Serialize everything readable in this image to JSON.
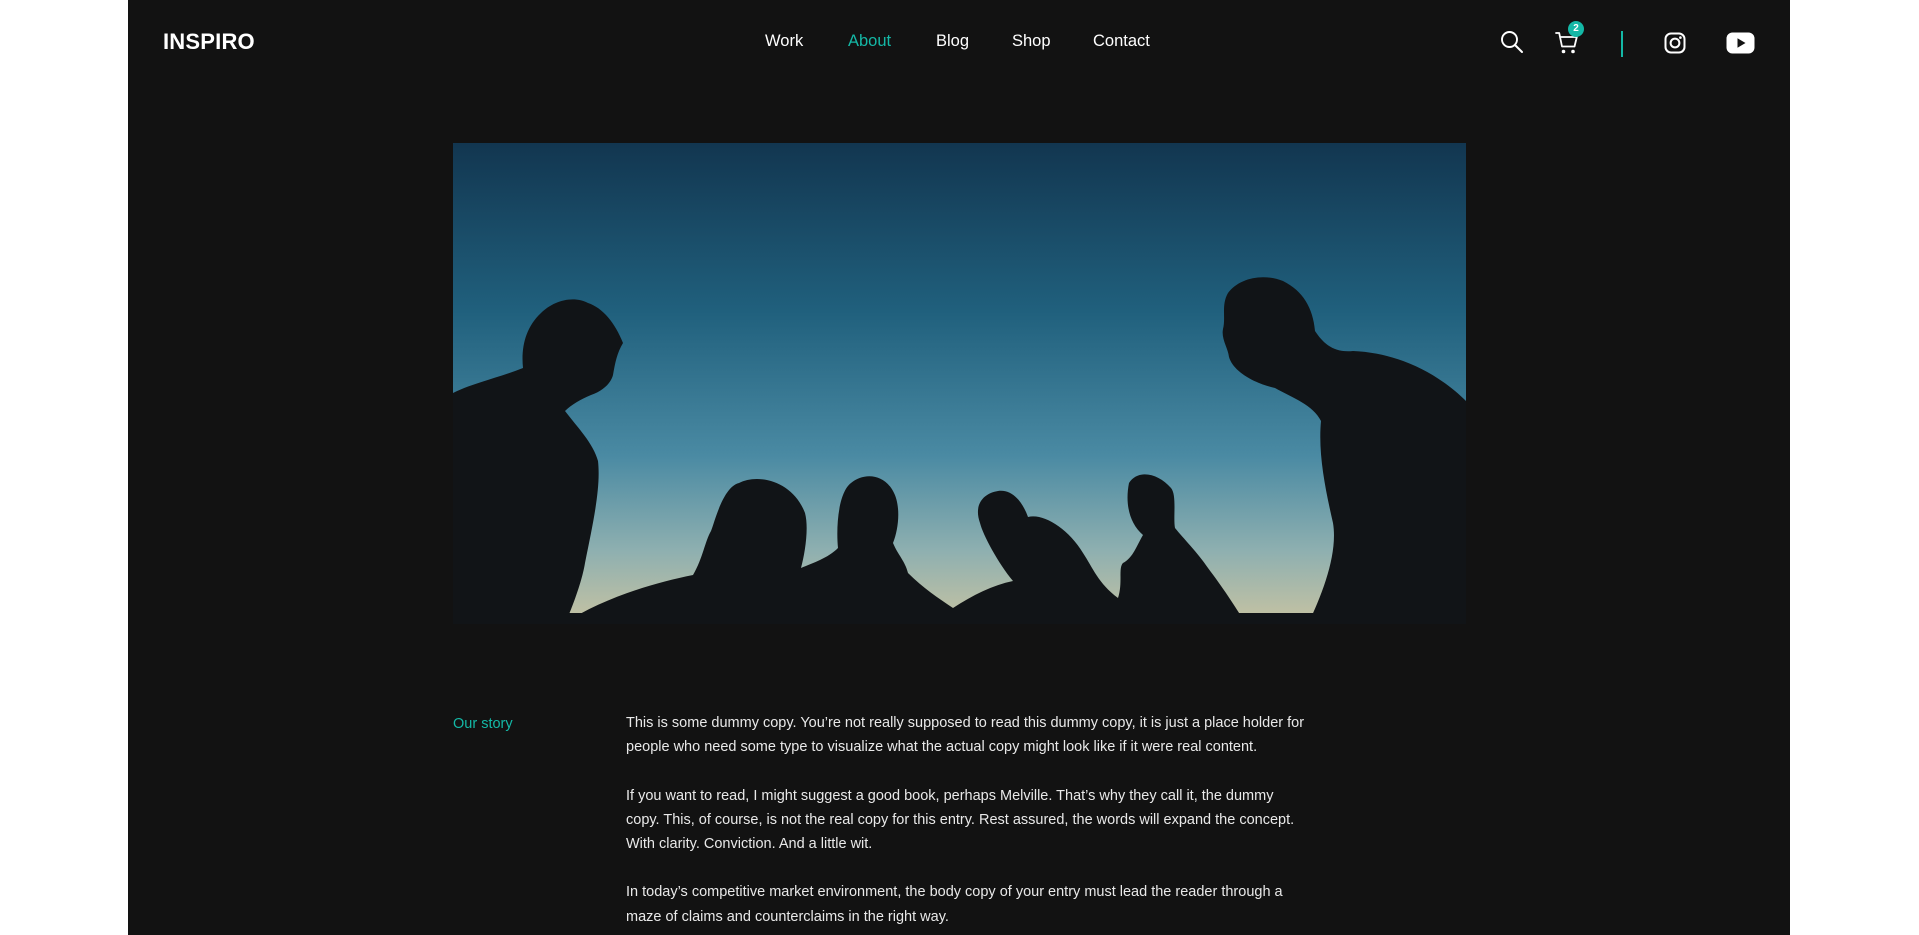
{
  "header": {
    "logo": "INSPIRO",
    "nav": [
      {
        "label": "Work",
        "active": false
      },
      {
        "label": "About",
        "active": true
      },
      {
        "label": "Blog",
        "active": false
      },
      {
        "label": "Shop",
        "active": false
      },
      {
        "label": "Contact",
        "active": false
      }
    ],
    "icons": [
      "search-icon",
      "cart-icon",
      "instagram-icon",
      "youtube-icon"
    ],
    "cart_count": "2"
  },
  "hero": {
    "image": "silhouettes-of-people-looking-down-against-blue-sky"
  },
  "story": {
    "label": "Our story",
    "paragraphs": [
      "This is some dummy copy. You’re not really supposed to read this dummy copy, it is just a place holder for people who need some type to visualize what the actual copy might look like if it were real content.",
      "If you want to read, I might suggest a good book, perhaps Melville. That’s why they call it, the dummy copy. This, of course, is not the real copy for this entry. Rest assured, the words will expand the concept. With clarity. Conviction. And a little wit.",
      "In today’s competitive market environment, the body copy of your entry must lead the reader through a maze of claims and counterclaims in the right way."
    ]
  },
  "colors": {
    "page_bg": "#121212",
    "outer_bg": "#ffffff",
    "accent": "#14b8a6",
    "text": "#ffffff"
  }
}
